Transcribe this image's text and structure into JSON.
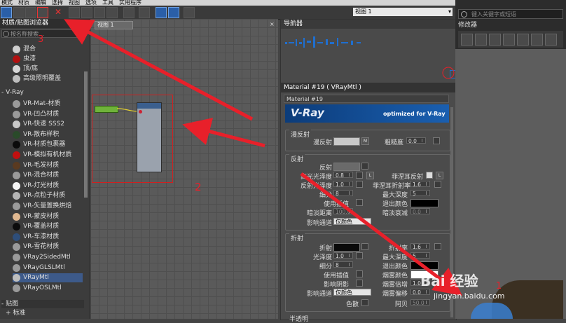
{
  "menubar": {
    "items": [
      "模式",
      "材质",
      "编辑",
      "选择",
      "视图",
      "选项",
      "工具",
      "实用程序"
    ]
  },
  "toolbar": {
    "view_dropdown": "视图 1"
  },
  "left_panel": {
    "title": "材质/贴图浏览器",
    "search_placeholder": "按名称搜索...",
    "top_items": [
      {
        "label": "混合",
        "color": "#cfcfcf"
      },
      {
        "label": "虫漆",
        "color": "#b01010"
      },
      {
        "label": "顶/底",
        "color": "#d6d6d6"
      },
      {
        "label": "高级照明覆盖",
        "color": "#bdbdbd"
      }
    ],
    "vray_group": "- V-Ray",
    "vray_items": [
      {
        "label": "VR-Mat-材质",
        "color": "#9a9a9a"
      },
      {
        "label": "VR-凹凸材质",
        "color": "#9a9a9a"
      },
      {
        "label": "VR-快速 SSS2",
        "color": "#c8c8c8"
      },
      {
        "label": "VR-散布样积",
        "color": "#2a4a2a"
      },
      {
        "label": "VR-材质包裹器",
        "color": "#0b0b0b"
      },
      {
        "label": "VR-模拟有机材质",
        "color": "#c01010"
      },
      {
        "label": "VR-毛发材质",
        "color": "#5a3a20"
      },
      {
        "label": "VR-混合材质",
        "color": "#9a9a9a"
      },
      {
        "label": "VR-灯光材质",
        "color": "#f5f5f5"
      },
      {
        "label": "VR-点粒子材质",
        "color": "#b5b5b5"
      },
      {
        "label": "VR-矢量置换烘焙",
        "color": "#9a9a9a"
      },
      {
        "label": "VR-蒙皮材质",
        "color": "#e0b890"
      },
      {
        "label": "VR-覆盖材质",
        "color": "#0c0c0c"
      },
      {
        "label": "VR-车漆材质",
        "color": "#2e4e7a"
      },
      {
        "label": "VR-雪花材质",
        "color": "#9a9a9a"
      },
      {
        "label": "VRay2SidedMtl",
        "color": "#9a9a9a"
      },
      {
        "label": "VRayGLSLMtl",
        "color": "#9a9a9a"
      },
      {
        "label": "VRayMtl",
        "color": "#bdbdbd"
      },
      {
        "label": "VRayOSLMtl",
        "color": "#9a9a9a"
      }
    ],
    "maps_group": "- 贴图",
    "standard_group": "+ 标准"
  },
  "node_view": {
    "tab": "视图 1"
  },
  "navigator": {
    "title": "导航器"
  },
  "material_panel": {
    "title": "Material #19  ( VRayMtl )",
    "name": "Material #19",
    "banner_logo": "V-Ray",
    "banner_text": "optimized for V-Ray",
    "diffuse": {
      "section": "漫反射",
      "diffuse_label": "漫反射",
      "m_button": "M",
      "roughness_label": "粗糙度",
      "roughness_value": "0.0"
    },
    "reflection": {
      "section": "反射",
      "reflect_label": "反射",
      "hilight_gloss_label": "高光光泽度",
      "hilight_gloss_value": "0.8",
      "l_button": "L",
      "fresnel_label": "菲涅耳反射",
      "refl_gloss_label": "反射光泽度",
      "refl_gloss_value": "1.0",
      "fresnel_ior_label": "菲涅耳折射率",
      "fresnel_ior_value": "1.6",
      "subdivs_label": "细分",
      "subdivs_value": "8",
      "max_depth_label": "最大深度",
      "max_depth_value": "5",
      "use_interp_label": "使用插值",
      "exit_color_label": "退出颜色",
      "dim_dist_label": "暗淡距离",
      "dim_dist_value": "100.0",
      "dim_falloff_label": "暗淡衰减",
      "dim_falloff_value": "0.0",
      "affect_channels_label": "影响通道",
      "affect_channels_value": "仅颜色"
    },
    "refraction": {
      "section": "折射",
      "refract_label": "折射",
      "ior_label": "折射率",
      "ior_value": "1.6",
      "gloss_label": "光泽度",
      "gloss_value": "1.0",
      "max_depth_label": "最大深度",
      "max_depth_value": "5",
      "subdivs_label": "细分",
      "subdivs_value": "8",
      "exit_color_label": "退出颜色",
      "use_interp_label": "使用插值",
      "fog_color_label": "烟雾颜色",
      "affect_shadows_label": "影响阴影",
      "fog_mult_label": "烟雾倍增",
      "fog_mult_value": "1.0",
      "affect_channels_label": "影响通道",
      "affect_channels_value": "仅颜色",
      "fog_bias_label": "烟雾偏移",
      "fog_bias_value": "0.0",
      "dispersion_label": "色散",
      "abbe_label": "阿贝",
      "abbe_value": "50.0"
    },
    "translucency_section": "半透明"
  },
  "right_area": {
    "search_placeholder": "键入关键字或短语",
    "modifier_title": "修改器"
  },
  "annotations": {
    "n1": "1",
    "n2": "2",
    "n3": "3"
  },
  "watermark": {
    "line1": "Bai 经验",
    "line2": "jingyan.baidu.com"
  },
  "colors": {
    "arrow": "#e8202a",
    "accent": "#2a5fa8",
    "selected": "#3d5a8a"
  }
}
